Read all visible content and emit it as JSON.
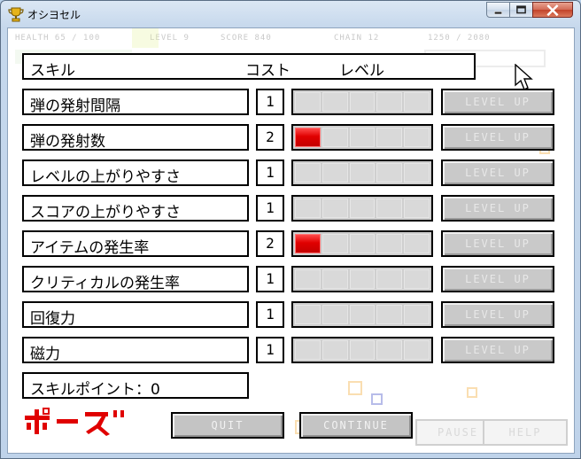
{
  "window": {
    "title": "オシヨセル"
  },
  "hud": {
    "health": "HEALTH 65 / 100",
    "level": "LEVEL 9",
    "score": "SCORE 840",
    "chain": "CHAIN 12",
    "exp": "1250 / 2080"
  },
  "header": {
    "skill": "スキル",
    "cost": "コスト",
    "level": "レベル"
  },
  "skills": [
    {
      "name": "弾の発射間隔",
      "cost": "1",
      "level": 0
    },
    {
      "name": "弾の発射数",
      "cost": "2",
      "level": 1
    },
    {
      "name": "レベルの上がりやすさ",
      "cost": "1",
      "level": 0
    },
    {
      "name": "スコアの上がりやすさ",
      "cost": "1",
      "level": 0
    },
    {
      "name": "アイテムの発生率",
      "cost": "2",
      "level": 1
    },
    {
      "name": "クリティカルの発生率",
      "cost": "1",
      "level": 0
    },
    {
      "name": "回復力",
      "cost": "1",
      "level": 0
    },
    {
      "name": "磁力",
      "cost": "1",
      "level": 0
    }
  ],
  "level_segments": 5,
  "level_up_label": "LEVEL UP",
  "skill_points": "スキルポイント：0",
  "pause_logo": "ポーズ",
  "buttons": {
    "quit": "QUIT",
    "continue": "CONTINUE",
    "pause": "PAUSE",
    "help": "HELP"
  },
  "colors": {
    "level_fill": "#e00000",
    "accent_red": "#e00000"
  }
}
